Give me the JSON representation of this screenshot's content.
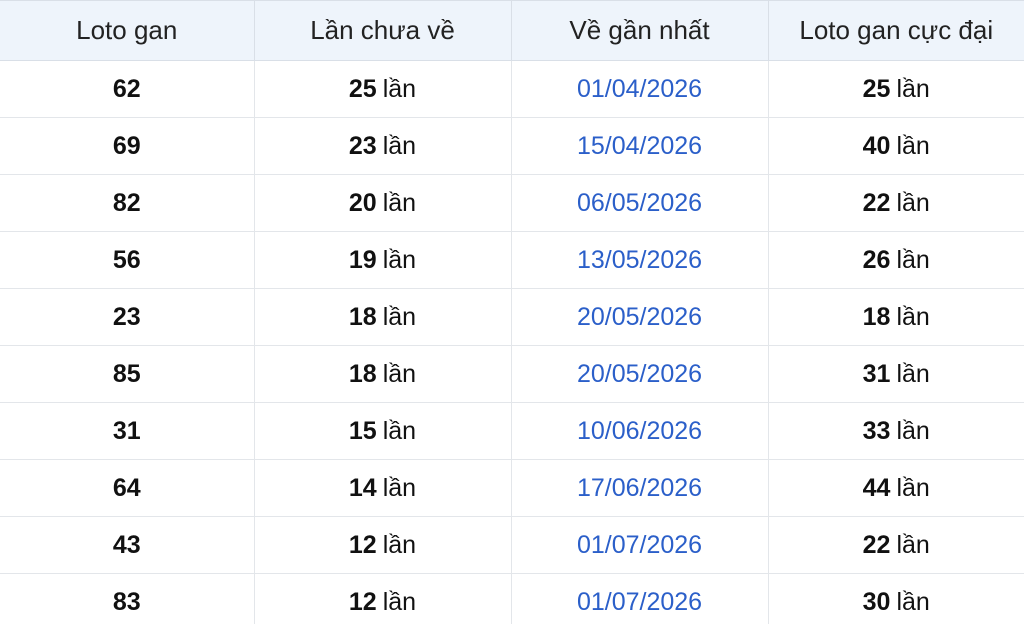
{
  "table": {
    "headers": [
      "Loto gan",
      "Lần chưa về",
      "Về gần nhất",
      "Loto gan cực đại"
    ],
    "unit": "lần",
    "rows": [
      {
        "loto": "62",
        "missed": "25",
        "last_date": "01/04/2026",
        "max_gan": "25"
      },
      {
        "loto": "69",
        "missed": "23",
        "last_date": "15/04/2026",
        "max_gan": "40"
      },
      {
        "loto": "82",
        "missed": "20",
        "last_date": "06/05/2026",
        "max_gan": "22"
      },
      {
        "loto": "56",
        "missed": "19",
        "last_date": "13/05/2026",
        "max_gan": "26"
      },
      {
        "loto": "23",
        "missed": "18",
        "last_date": "20/05/2026",
        "max_gan": "18"
      },
      {
        "loto": "85",
        "missed": "18",
        "last_date": "20/05/2026",
        "max_gan": "31"
      },
      {
        "loto": "31",
        "missed": "15",
        "last_date": "10/06/2026",
        "max_gan": "33"
      },
      {
        "loto": "64",
        "missed": "14",
        "last_date": "17/06/2026",
        "max_gan": "44"
      },
      {
        "loto": "43",
        "missed": "12",
        "last_date": "01/07/2026",
        "max_gan": "22"
      },
      {
        "loto": "83",
        "missed": "12",
        "last_date": "01/07/2026",
        "max_gan": "30"
      }
    ]
  },
  "colors": {
    "header_bg": "#eef4fb",
    "date_link": "#2b5fc9",
    "grid_line": "#e3e6ea"
  }
}
